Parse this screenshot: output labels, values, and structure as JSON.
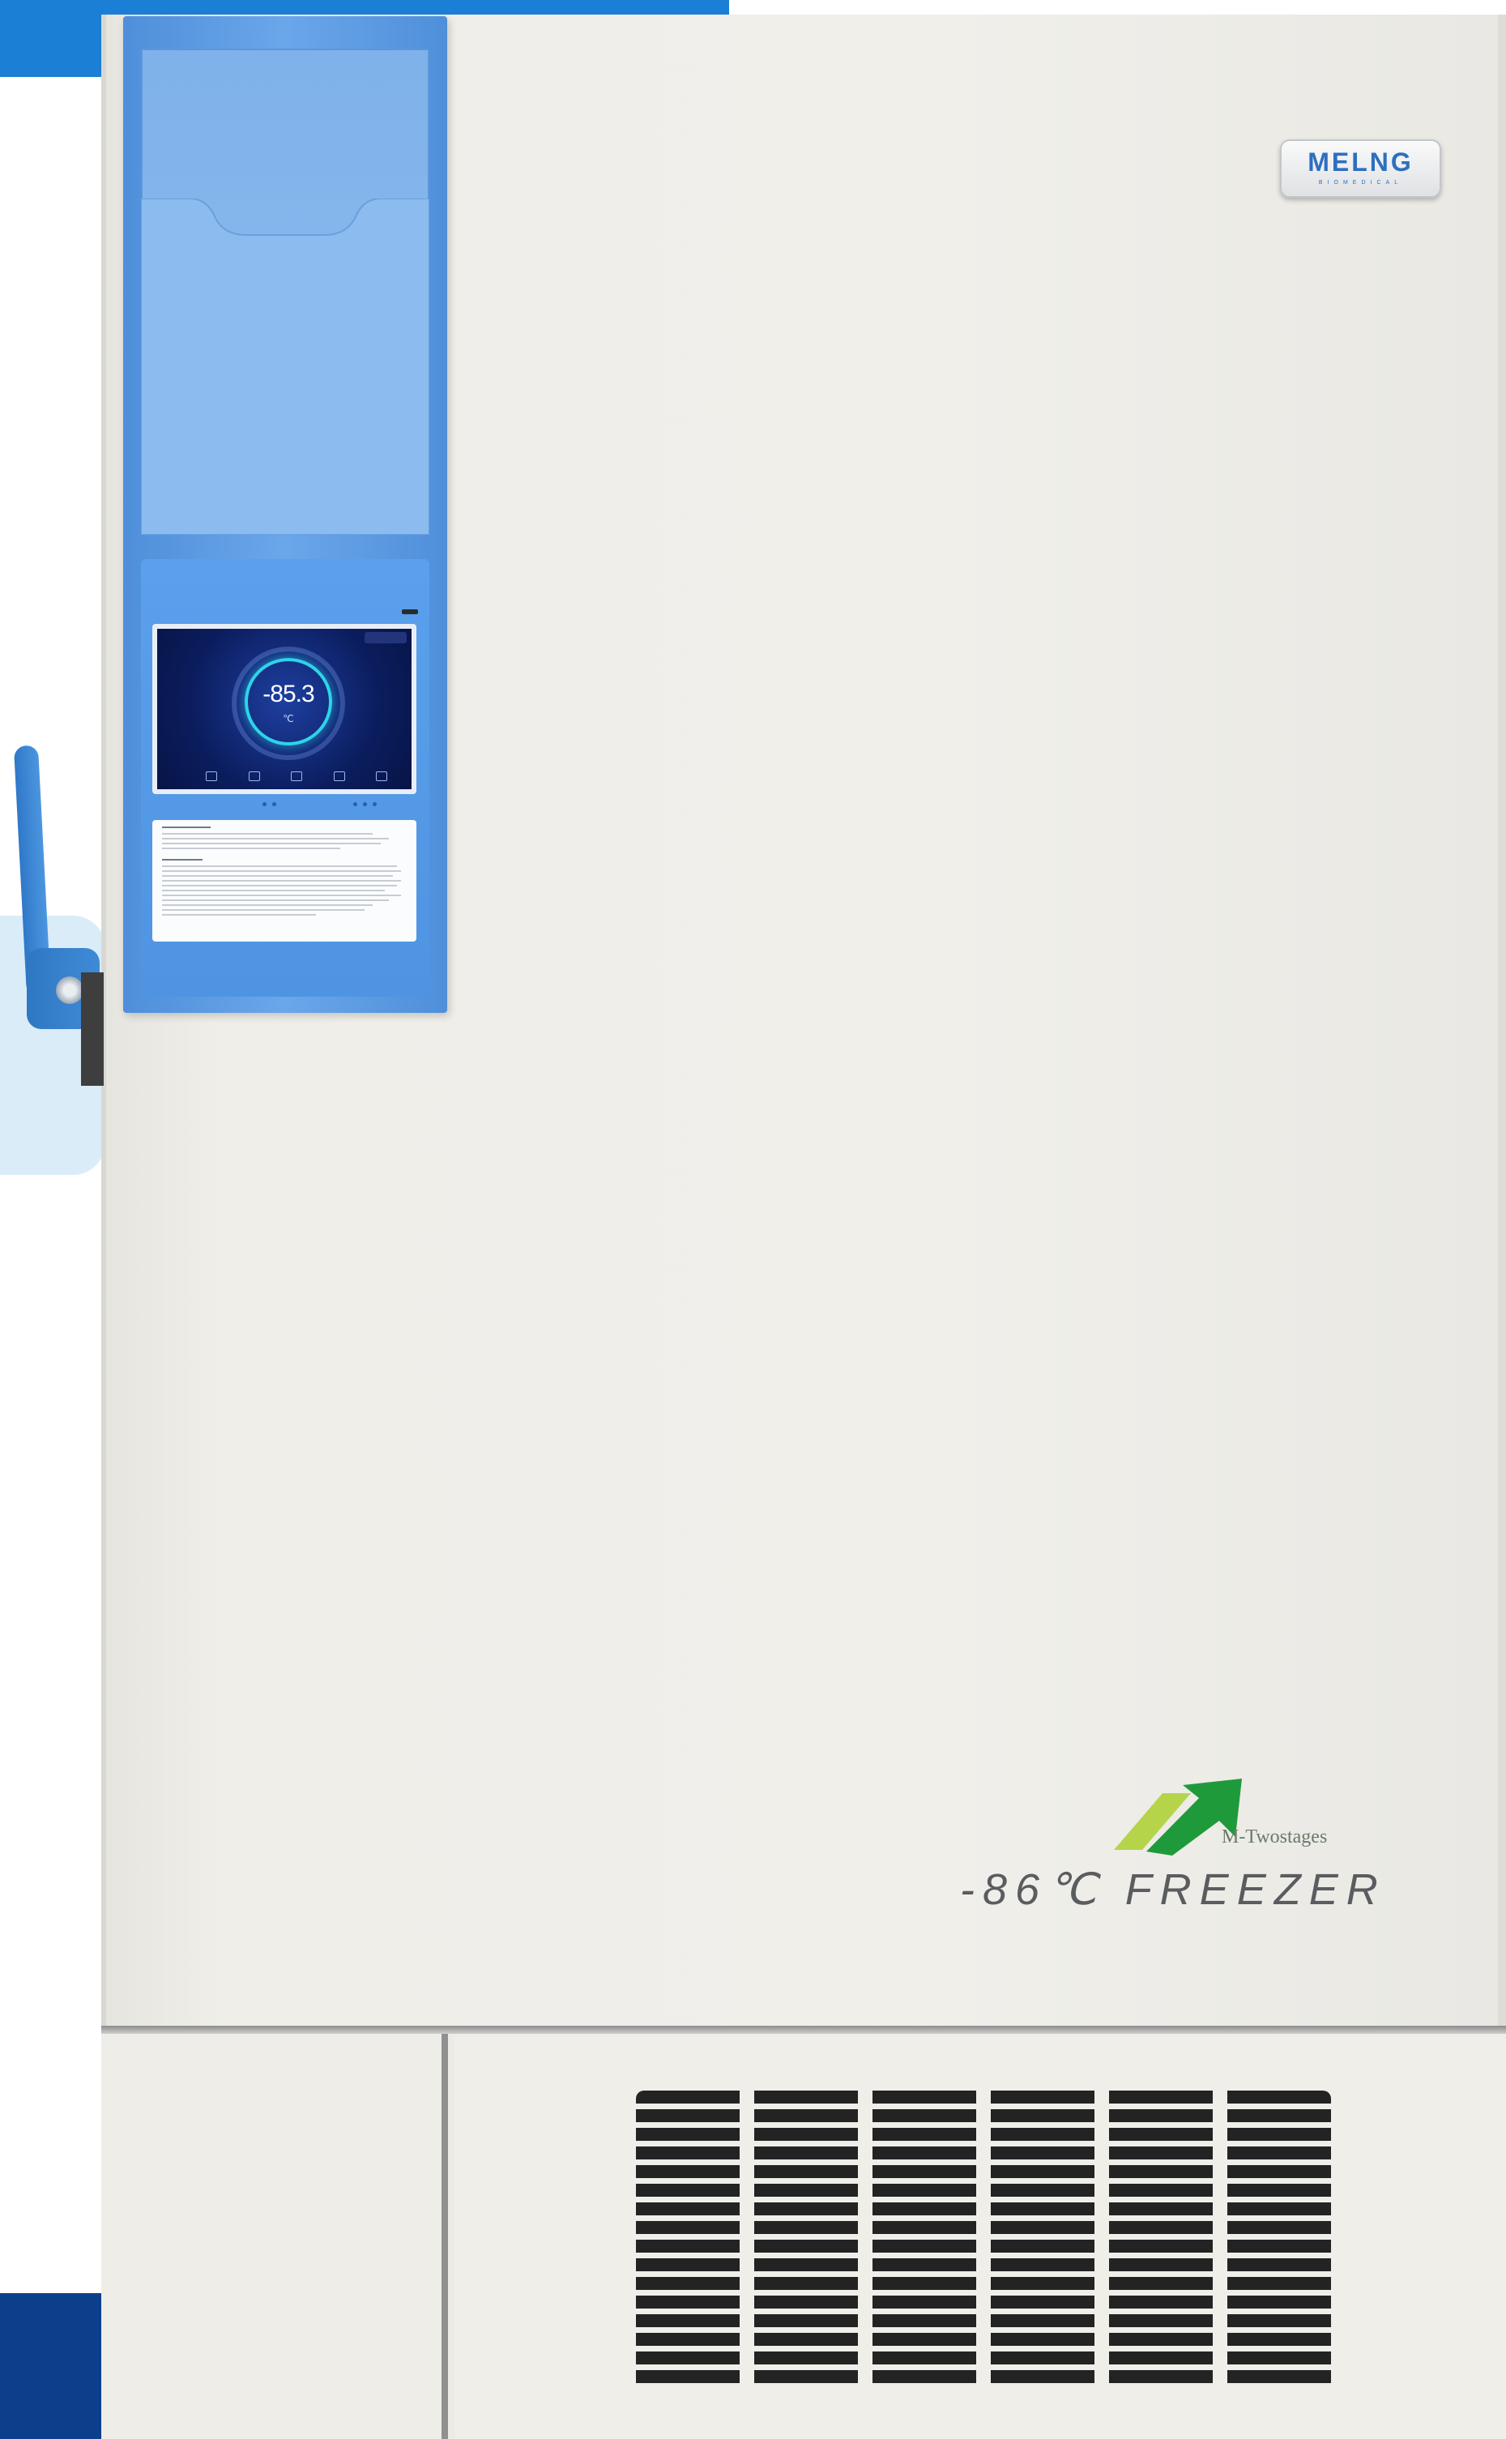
{
  "brand": {
    "name": "MELNG",
    "tagline": "BIOMEDICAL",
    "accent_color": "#2d6fbf"
  },
  "product": {
    "technology": "M-Twostages",
    "title": "-86℃ FREEZER"
  },
  "display": {
    "temperature": "-85.3",
    "unit": "℃",
    "ring_color": "#2ed4e8"
  },
  "icons": {
    "handle": "door-handle-icon",
    "badge": "green-arrow-icon",
    "vent": "ventilation-grille"
  }
}
